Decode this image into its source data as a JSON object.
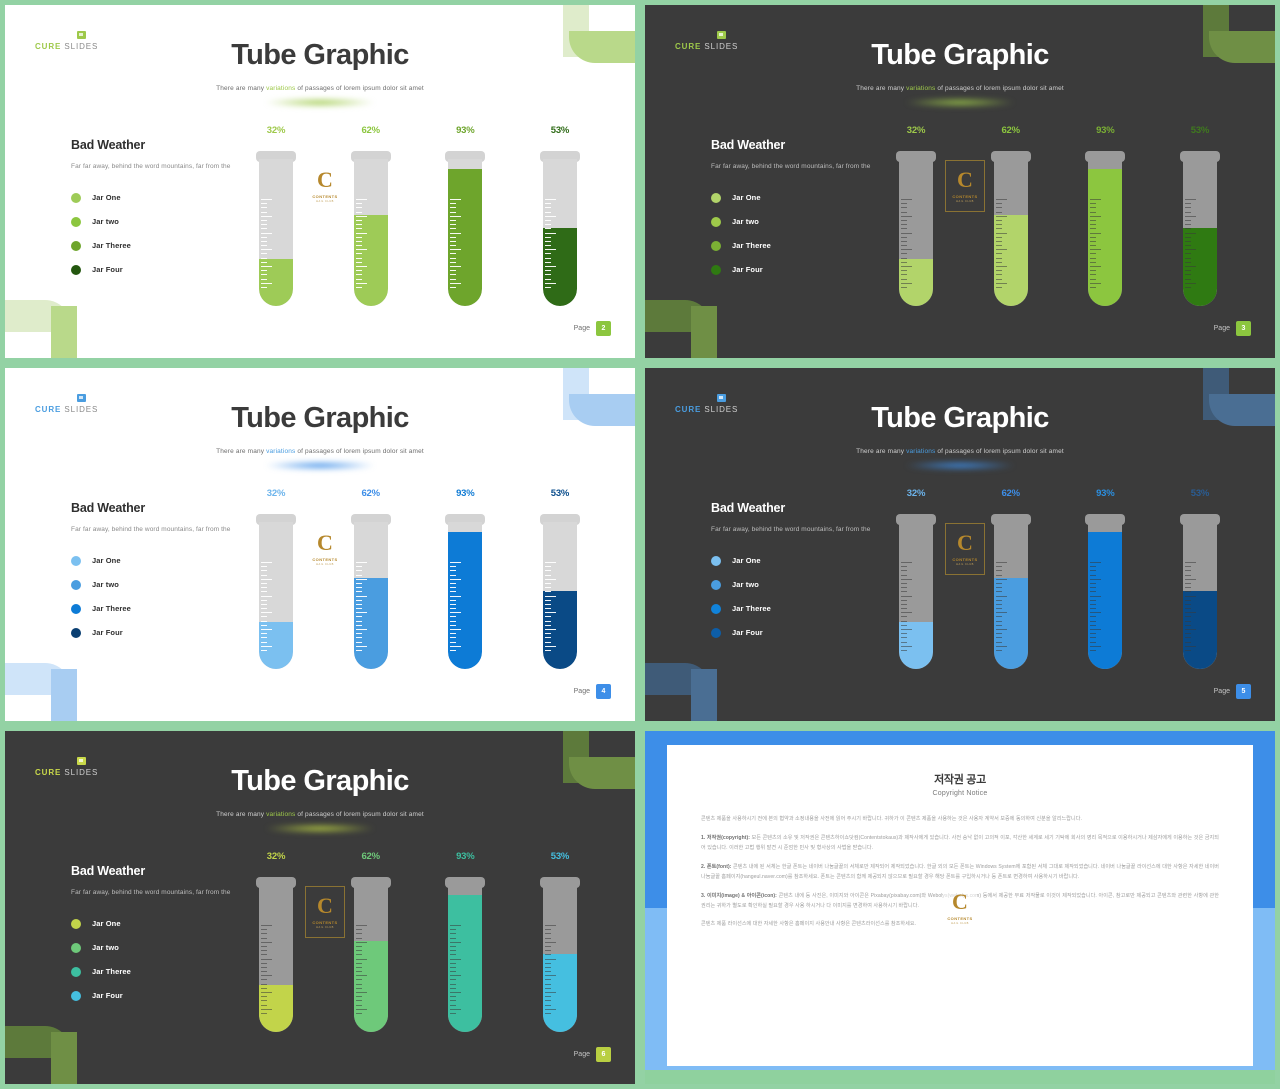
{
  "brand": {
    "logo_primary": "CURE",
    "logo_secondary": "SLIDES"
  },
  "common": {
    "title": "Tube Graphic",
    "subtitle_before": "There are many ",
    "subtitle_highlight": "variations",
    "subtitle_after": " of  passages of lorem ipsum dolor sit amet",
    "panel_heading": "Bad Weather",
    "panel_body": "Far far away,  behind  the word mountains,  far from the",
    "page_label": "Page",
    "watermark": {
      "letter": "C",
      "line1": "CONTENTS",
      "line2": "HAIL CLUB"
    }
  },
  "chart_data": {
    "type": "bar",
    "title": "Tube Graphic",
    "subtitle": "There are many variations of passages of lorem ipsum dolor sit amet",
    "categories": [
      "Jar One",
      "Jar two",
      "Jar Theree",
      "Jar Four"
    ],
    "values": [
      32,
      62,
      93,
      53
    ],
    "labels": [
      "32%",
      "62%",
      "93%",
      "53%"
    ],
    "unit": "%",
    "ylim": [
      0,
      100
    ],
    "grid": false,
    "legend": "left",
    "xlabel": "",
    "ylabel": ""
  },
  "slides": [
    {
      "id": "slide-green-light",
      "theme": "light",
      "background": "#ffffff",
      "accent": "#8cc63f",
      "deco_a": "#dfeccb",
      "deco_b": "#b9d98a",
      "logo_primary_color": "#9ec94a",
      "logo_secondary_color": "#8a8a8a",
      "logo_mark_color": "#9ec94a",
      "highlight_color": "#9ec94a",
      "glow_color": "#9ec94a",
      "page_number": "2",
      "page_badge_color": "#8cc63f",
      "pct_colors": [
        "#9ec94a",
        "#8cc63f",
        "#6ea52c",
        "#2f6b17"
      ],
      "fill_colors": [
        "#9ecb57",
        "#9ecb57",
        "#6ea52c",
        "#2f6b17"
      ],
      "legend_colors": [
        "#9ecb57",
        "#8cc63f",
        "#6ea52c",
        "#24570f"
      ]
    },
    {
      "id": "slide-green-dark",
      "theme": "dark",
      "background": "#3b3b3b",
      "accent": "#8cc63f",
      "deco_a": "#5d7a3b",
      "deco_b": "#6f8f45",
      "logo_primary_color": "#9ec94a",
      "logo_secondary_color": "#cfcfcf",
      "logo_mark_color": "#9ec94a",
      "highlight_color": "#9ec94a",
      "glow_color": "#9ec94a",
      "page_number": "3",
      "page_badge_color": "#8cc63f",
      "pct_colors": [
        "#9ec94a",
        "#8cc63f",
        "#7bb034",
        "#3f7a1e"
      ],
      "fill_colors": [
        "#b2d46a",
        "#b2d46a",
        "#8cc63f",
        "#2f7a12"
      ],
      "legend_colors": [
        "#b2d46a",
        "#9ec94a",
        "#7bb034",
        "#2f7a12"
      ]
    },
    {
      "id": "slide-blue-light",
      "theme": "light",
      "background": "#ffffff",
      "accent": "#2b8fe0",
      "deco_a": "#cfe4f9",
      "deco_b": "#a8cdf2",
      "logo_primary_color": "#4a9de0",
      "logo_secondary_color": "#8a8a8a",
      "logo_mark_color": "#4a9de0",
      "highlight_color": "#4a9de0",
      "glow_color": "#3d8ee8",
      "page_number": "4",
      "page_badge_color": "#3d8ee8",
      "pct_colors": [
        "#6cb4ec",
        "#3d8ee8",
        "#0f7bd4",
        "#0a4d8c"
      ],
      "fill_colors": [
        "#7bc0f0",
        "#4a9de0",
        "#0d7bd6",
        "#0a4a86"
      ],
      "legend_colors": [
        "#7bc0f0",
        "#4a9de0",
        "#0d7bd6",
        "#0a3f72"
      ]
    },
    {
      "id": "slide-blue-dark",
      "theme": "dark",
      "background": "#3b3b3b",
      "accent": "#2b8fe0",
      "deco_a": "#3f5b78",
      "deco_b": "#4a6e93",
      "logo_primary_color": "#4a9de0",
      "logo_secondary_color": "#cfcfcf",
      "logo_mark_color": "#4a9de0",
      "highlight_color": "#4a9de0",
      "glow_color": "#3d8ee8",
      "page_number": "5",
      "page_badge_color": "#3d8ee8",
      "pct_colors": [
        "#6cb4ec",
        "#3d8ee8",
        "#2b8fe0",
        "#2a5d94"
      ],
      "fill_colors": [
        "#7bc0f0",
        "#4a9de0",
        "#0d7bd6",
        "#0a4a86"
      ],
      "legend_colors": [
        "#7bc0f0",
        "#4a9de0",
        "#1183da",
        "#0d5ea8"
      ]
    },
    {
      "id": "slide-multi-dark",
      "theme": "dark",
      "background": "#3b3b3b",
      "accent": "#9ec94a",
      "deco_a": "#5d7a3b",
      "deco_b": "#6f8f45",
      "logo_primary_color": "#c9d94a",
      "logo_secondary_color": "#cfcfcf",
      "logo_mark_color": "#c9d94a",
      "highlight_color": "#9ec94a",
      "glow_color": "#b9cf42",
      "page_number": "6",
      "page_badge_color": "#b9cf42",
      "pct_colors": [
        "#c2d44a",
        "#6ec97a",
        "#3dbfa0",
        "#45bfe0"
      ],
      "fill_colors": [
        "#c2d44a",
        "#6ec97a",
        "#3dbfa0",
        "#45bfe0"
      ],
      "legend_colors": [
        "#c2d44a",
        "#6ec97a",
        "#3dbfa0",
        "#45bfe0"
      ]
    }
  ],
  "copyright": {
    "heading_ko": "저작권 공고",
    "heading_en": "Copyright Notice",
    "paragraphs": [
      "콘텐츠 제품을 사용하시기 전에 본의 협약과 소정내용을 사전에 읽어 주시기 바랍니다. 귀하가 이 콘텐츠 제품을 사용하는 것은 사용자 계약서 보증에 동의하여 신분을 알리느랍니다.",
      "1. 저작권(copyright): 모든 콘텐츠의 소유 및 저작권은 콘텐츠하이쇼닷컴(Contentstokaus)과 제작사에게 있습니다. 사전 승낙 없이 고의적 이포, 각산한 세계로 세기 기탁에 회사의 영리 목적으로 이용하시거나 제삼자에게 이용하는 것은 금지되어 있습니다. 이러한 고법 행위 발견 시 준엄한 민사 및 형사상의 사법을 받습니다.",
      "2. 폰트(font): 콘텐츠 내에 된 서체는 한글 폰트는 네이버 나눔글꼴의 서체로만 제작되어 제작되었습니다. 한글 외의 모든 폰트는 Windows System에 포함된 서체 그대로 제작되었습니다. 네이버 나눔글꼴 라이선스에 대한 사항은 자세한 네이버 나눔글꼴 홈페이지(hangeul.naver.com)를 참조하세요. 폰트는 콘텐츠의 함께 제공되지 않으므로 필요할 경우 해당 폰트를 구입하시거나 등 폰트로 변경하여 사용하시기 바랍니다.",
      "3. 이미지(image) & 아이콘(icon): 콘텐츠 내에 등 사진은, 이미지와 아이콘은 Pixabay(pixabay.com)와 Webolys(webolys.com) 등에서 제공한 무료 저작물로 이것이 제작되었습니다. 아이콘, 참고로만 제공되고 콘텐츠와 관련한 사항에 관한 권리는 귀하가 별도로 확인하실 필요할 경우 사용 하시거나 다 이미지를 변경하여 사용하시기 바랍니다.",
      "콘텐츠 제품 라이선스에 대한 자세한 사항은 홈페이지 사용안내 사항은 콘텐츠라이선스를 참조하세요."
    ],
    "watermark_letter": "C"
  }
}
